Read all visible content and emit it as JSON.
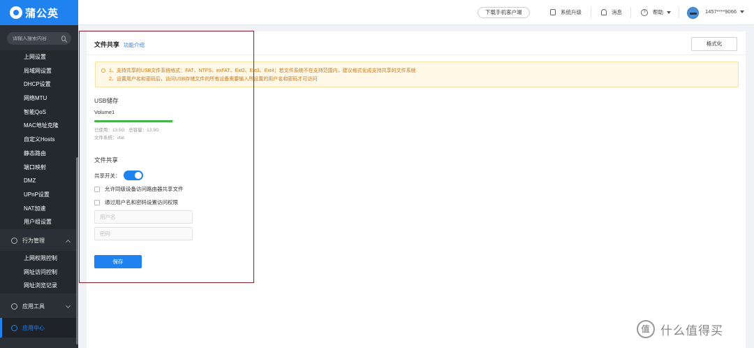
{
  "app": {
    "name": "蒲公英"
  },
  "sidebar": {
    "search_placeholder": "请输入搜索内容",
    "network_items": [
      {
        "label": "上网设置"
      },
      {
        "label": "局域网设置"
      },
      {
        "label": "DHCP设置"
      },
      {
        "label": "网络MTU"
      },
      {
        "label": "智能QoS"
      },
      {
        "label": "MAC地址克隆"
      },
      {
        "label": "自定义Hosts"
      },
      {
        "label": "静态路由"
      },
      {
        "label": "端口映射"
      },
      {
        "label": "DMZ"
      },
      {
        "label": "UPnP设置"
      },
      {
        "label": "NAT加速"
      },
      {
        "label": "用户组设置"
      }
    ],
    "behavior_group": {
      "label": "行为管理",
      "items": [
        {
          "label": "上网权限控制"
        },
        {
          "label": "网址访问控制"
        },
        {
          "label": "网址浏览记录"
        }
      ]
    },
    "tools_group": {
      "label": "应用工具"
    },
    "app_center": {
      "label": "应用中心"
    }
  },
  "topbar": {
    "download_label": "下载手机客户端",
    "upgrade_label": "系统升级",
    "messages_label": "消息",
    "help_label": "帮助",
    "user_label": "1457****9066"
  },
  "page": {
    "title": "文件共享",
    "intro_link": "功能介绍",
    "format_button": "格式化",
    "notice_line1": "1、支持共享的USB文件系统格式：FAT、NTFS、exFAT、Ext2、Ext3、Ext4；若文件系统不在支持范围内，建议格式化成支持共享的文件系统",
    "notice_line2": "2、设置用户名和密码后，访问USB存储文件的所有设备需要输入所设置的用户名和密码才可访问"
  },
  "usb": {
    "section_title": "USB储存",
    "volume_name": "Volume1",
    "used_label": "已使用：",
    "used_value": "13.5G",
    "total_label": "总容量：",
    "total_value": "13.9G",
    "fs_label": "文件系统：",
    "fs_value": "vfat",
    "usage_fraction": 0.97,
    "bar_color": "#44b549"
  },
  "share": {
    "section_title": "文件共享",
    "switch_label": "共享开关：",
    "switch_on": true,
    "allow_peer_label": "允许同级设备访问路由器共享文件",
    "auth_label": "通过用户名和密码设置访问权限",
    "username_placeholder": "用户名",
    "password_placeholder": "密码",
    "save_button": "保存"
  },
  "watermark": {
    "text": "什么值得买",
    "icon_text": "值"
  },
  "colors": {
    "accent": "#1f82ef",
    "sidebar_bg": "#2b3036",
    "highlight_border": "#8b1a2a",
    "notice_text": "#c7781a"
  }
}
